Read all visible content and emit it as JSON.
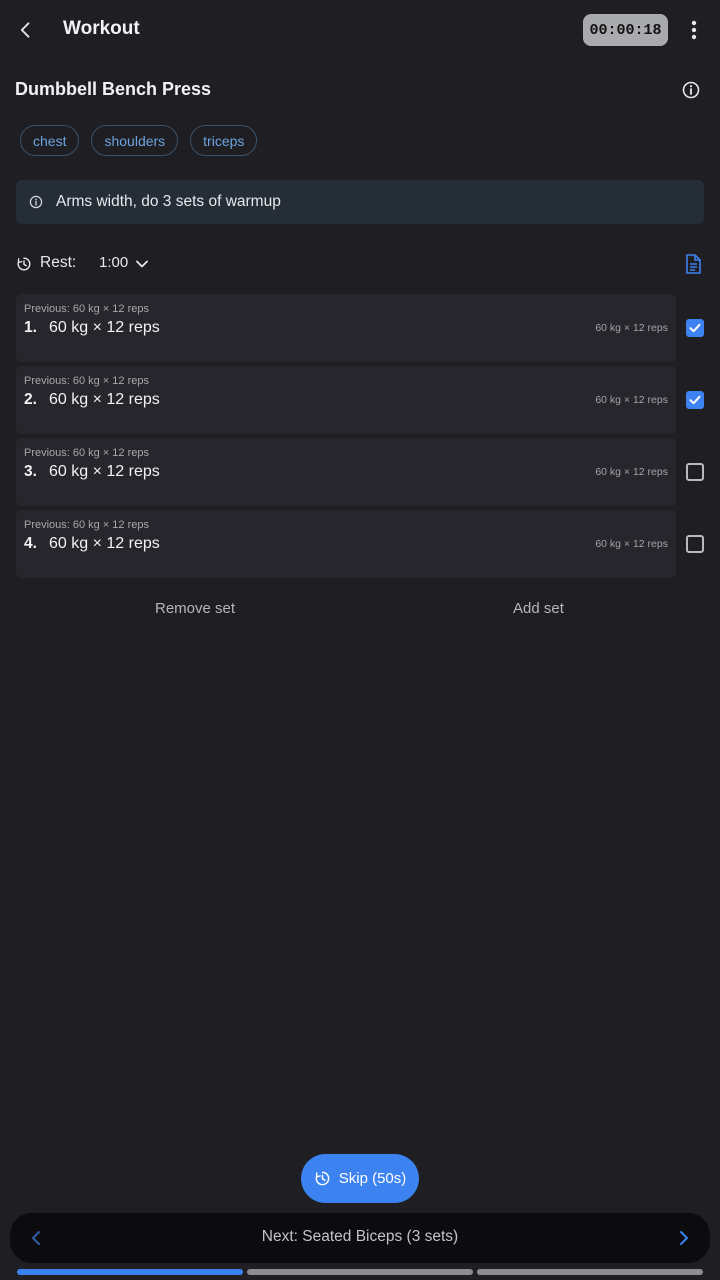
{
  "header": {
    "title": "Workout",
    "timer": "00:00:18",
    "icons": {
      "back": "chevron-left-icon",
      "more": "more-vert-icon"
    }
  },
  "exercise": {
    "name": "Dumbbell Bench Press",
    "tags": [
      "chest",
      "shoulders",
      "triceps"
    ],
    "note": "Arms width, do 3 sets of warmup"
  },
  "rest": {
    "label": "Rest:",
    "value": "1:00"
  },
  "sets": [
    {
      "number": "1.",
      "value": "60 kg × 12 reps",
      "previous_label": "Previous:",
      "previous_value": "60 kg × 12 reps",
      "right_hint": "60 kg × 12 reps",
      "completed": true
    },
    {
      "number": "2.",
      "value": "60 kg × 12 reps",
      "previous_label": "Previous:",
      "previous_value": "60 kg × 12 reps",
      "right_hint": "60 kg × 12 reps",
      "completed": true
    },
    {
      "number": "3.",
      "value": "60 kg × 12 reps",
      "previous_label": "Previous:",
      "previous_value": "60 kg × 12 reps",
      "right_hint": "60 kg × 12 reps",
      "completed": false
    },
    {
      "number": "4.",
      "value": "60 kg × 12 reps",
      "previous_label": "Previous:",
      "previous_value": "60 kg × 12 reps",
      "right_hint": "60 kg × 12 reps",
      "completed": false
    }
  ],
  "actions": {
    "remove_set": "Remove set",
    "add_set": "Add set"
  },
  "skip": {
    "label": "Skip (50s)"
  },
  "bottom_nav": {
    "next_label": "Next: Seated Biceps (3 sets)",
    "progress": {
      "segments": 3,
      "current": 1
    }
  },
  "colors": {
    "background": "#1e1e23",
    "accent": "#3c82f0",
    "tag_text": "#6ea3e0",
    "note_bg": "#252d37",
    "card_bg": "#26262c",
    "timer_bg": "#a9aaae",
    "progress_inactive": "#8c8c92"
  }
}
